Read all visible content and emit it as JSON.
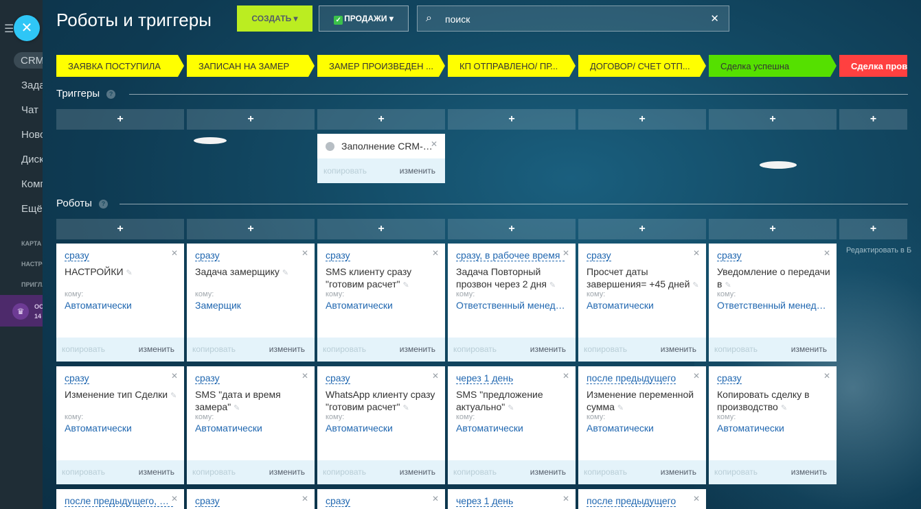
{
  "sidebar": {
    "items": [
      "CRM",
      "Задачи",
      "Чат",
      "Новости",
      "Диск",
      "Компания",
      "Ещё"
    ],
    "sections": [
      "КАРТА",
      "НАСТРОЙКИ",
      "ПРИГЛАСИТЬ"
    ],
    "promo": [
      "ОСТАЛОСЬ",
      "14"
    ]
  },
  "header": {
    "title": "Роботы и триггеры",
    "create_label": "СОЗДАТЬ",
    "pipeline_label": "ПРОДАЖИ",
    "search_value": "поиск"
  },
  "stages": [
    {
      "label": "ЗАЯВКА ПОСТУПИЛА",
      "color": "#ffff00"
    },
    {
      "label": "ЗАПИСАН НА ЗАМЕР",
      "color": "#ffff00"
    },
    {
      "label": "ЗАМЕР ПРОИЗВЕДЕН ...",
      "color": "#ffff00"
    },
    {
      "label": "КП ОТПРАВЛЕНО/ ПР...",
      "color": "#ffff00"
    },
    {
      "label": "ДОГОВОР/ СЧЕТ ОТП...",
      "color": "#ffff00"
    },
    {
      "label": "Сделка успешна",
      "color": "#55e000"
    },
    {
      "label": "Сделка провалена",
      "color": "#ff4040"
    }
  ],
  "triggers": {
    "title": "Триггеры",
    "help": "?",
    "add_label": "+",
    "card": {
      "name": "Заполнение CRM-формы",
      "copy": "копировать",
      "edit": "изменить"
    }
  },
  "robots": {
    "title": "Роботы",
    "help": "?",
    "add_label": "+",
    "to_label": "кому:",
    "copy_label": "копировать",
    "edit_label": "изменить",
    "side_note": "Редактировать в Бизнес-процессах Копировать роботов",
    "row1": [
      {
        "delay": "сразу",
        "name": "НАСТРОЙКИ",
        "resp": "Автоматически"
      },
      {
        "delay": "сразу",
        "name": "Задача замерщику",
        "resp": "Замерщик"
      },
      {
        "delay": "сразу",
        "name": "SMS клиенту сразу \"готовим расчет\"",
        "resp": "Автоматически"
      },
      {
        "delay": "сразу, в рабочее время",
        "name": "Задача Повторный прозвон через 2 дня",
        "resp": "Ответственный менеджер"
      },
      {
        "delay": "сразу",
        "name": "Просчет даты завершения= +45 дней",
        "resp": "Автоматически"
      },
      {
        "delay": "сразу",
        "name": "Уведомление о передачи в",
        "resp": "Ответственный менеджер"
      }
    ],
    "row2": [
      {
        "delay": "сразу",
        "name": "Изменение тип Сделки",
        "resp": "Автоматически"
      },
      {
        "delay": "сразу",
        "name": "SMS \"дата и время замера\"",
        "resp": "Автоматически"
      },
      {
        "delay": "сразу",
        "name": "WhatsApp клиенту сразу \"готовим расчет\"",
        "resp": "Автоматически"
      },
      {
        "delay": "через 1 день",
        "name": "SMS \"предложение актуально\"",
        "resp": "Автоматически"
      },
      {
        "delay": "после предыдущего",
        "name": "Изменение переменной сумма",
        "resp": "Автоматически"
      },
      {
        "delay": "сразу",
        "name": "Копировать сделку в производство",
        "resp": "Автоматически"
      }
    ],
    "row3": [
      {
        "delay": "после предыдущего, в рабочее время"
      },
      {
        "delay": "сразу"
      },
      {
        "delay": "сразу"
      },
      {
        "delay": "через 1 день"
      },
      {
        "delay": "после предыдущего"
      }
    ]
  }
}
